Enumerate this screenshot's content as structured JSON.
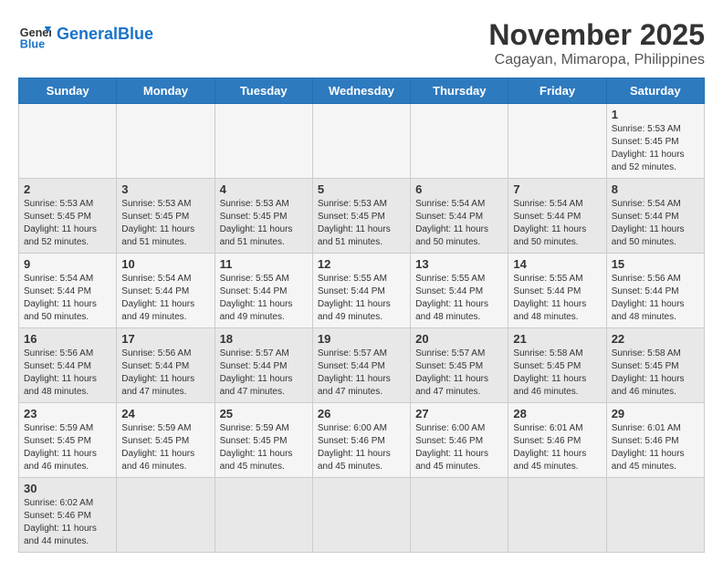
{
  "header": {
    "logo_general": "General",
    "logo_blue": "Blue",
    "month_title": "November 2025",
    "location": "Cagayan, Mimaropa, Philippines"
  },
  "weekdays": [
    "Sunday",
    "Monday",
    "Tuesday",
    "Wednesday",
    "Thursday",
    "Friday",
    "Saturday"
  ],
  "weeks": [
    [
      {
        "day": "",
        "info": ""
      },
      {
        "day": "",
        "info": ""
      },
      {
        "day": "",
        "info": ""
      },
      {
        "day": "",
        "info": ""
      },
      {
        "day": "",
        "info": ""
      },
      {
        "day": "",
        "info": ""
      },
      {
        "day": "1",
        "info": "Sunrise: 5:53 AM\nSunset: 5:45 PM\nDaylight: 11 hours\nand 52 minutes."
      }
    ],
    [
      {
        "day": "2",
        "info": "Sunrise: 5:53 AM\nSunset: 5:45 PM\nDaylight: 11 hours\nand 52 minutes."
      },
      {
        "day": "3",
        "info": "Sunrise: 5:53 AM\nSunset: 5:45 PM\nDaylight: 11 hours\nand 51 minutes."
      },
      {
        "day": "4",
        "info": "Sunrise: 5:53 AM\nSunset: 5:45 PM\nDaylight: 11 hours\nand 51 minutes."
      },
      {
        "day": "5",
        "info": "Sunrise: 5:53 AM\nSunset: 5:45 PM\nDaylight: 11 hours\nand 51 minutes."
      },
      {
        "day": "6",
        "info": "Sunrise: 5:54 AM\nSunset: 5:44 PM\nDaylight: 11 hours\nand 50 minutes."
      },
      {
        "day": "7",
        "info": "Sunrise: 5:54 AM\nSunset: 5:44 PM\nDaylight: 11 hours\nand 50 minutes."
      },
      {
        "day": "8",
        "info": "Sunrise: 5:54 AM\nSunset: 5:44 PM\nDaylight: 11 hours\nand 50 minutes."
      }
    ],
    [
      {
        "day": "9",
        "info": "Sunrise: 5:54 AM\nSunset: 5:44 PM\nDaylight: 11 hours\nand 50 minutes."
      },
      {
        "day": "10",
        "info": "Sunrise: 5:54 AM\nSunset: 5:44 PM\nDaylight: 11 hours\nand 49 minutes."
      },
      {
        "day": "11",
        "info": "Sunrise: 5:55 AM\nSunset: 5:44 PM\nDaylight: 11 hours\nand 49 minutes."
      },
      {
        "day": "12",
        "info": "Sunrise: 5:55 AM\nSunset: 5:44 PM\nDaylight: 11 hours\nand 49 minutes."
      },
      {
        "day": "13",
        "info": "Sunrise: 5:55 AM\nSunset: 5:44 PM\nDaylight: 11 hours\nand 48 minutes."
      },
      {
        "day": "14",
        "info": "Sunrise: 5:55 AM\nSunset: 5:44 PM\nDaylight: 11 hours\nand 48 minutes."
      },
      {
        "day": "15",
        "info": "Sunrise: 5:56 AM\nSunset: 5:44 PM\nDaylight: 11 hours\nand 48 minutes."
      }
    ],
    [
      {
        "day": "16",
        "info": "Sunrise: 5:56 AM\nSunset: 5:44 PM\nDaylight: 11 hours\nand 48 minutes."
      },
      {
        "day": "17",
        "info": "Sunrise: 5:56 AM\nSunset: 5:44 PM\nDaylight: 11 hours\nand 47 minutes."
      },
      {
        "day": "18",
        "info": "Sunrise: 5:57 AM\nSunset: 5:44 PM\nDaylight: 11 hours\nand 47 minutes."
      },
      {
        "day": "19",
        "info": "Sunrise: 5:57 AM\nSunset: 5:44 PM\nDaylight: 11 hours\nand 47 minutes."
      },
      {
        "day": "20",
        "info": "Sunrise: 5:57 AM\nSunset: 5:45 PM\nDaylight: 11 hours\nand 47 minutes."
      },
      {
        "day": "21",
        "info": "Sunrise: 5:58 AM\nSunset: 5:45 PM\nDaylight: 11 hours\nand 46 minutes."
      },
      {
        "day": "22",
        "info": "Sunrise: 5:58 AM\nSunset: 5:45 PM\nDaylight: 11 hours\nand 46 minutes."
      }
    ],
    [
      {
        "day": "23",
        "info": "Sunrise: 5:59 AM\nSunset: 5:45 PM\nDaylight: 11 hours\nand 46 minutes."
      },
      {
        "day": "24",
        "info": "Sunrise: 5:59 AM\nSunset: 5:45 PM\nDaylight: 11 hours\nand 46 minutes."
      },
      {
        "day": "25",
        "info": "Sunrise: 5:59 AM\nSunset: 5:45 PM\nDaylight: 11 hours\nand 45 minutes."
      },
      {
        "day": "26",
        "info": "Sunrise: 6:00 AM\nSunset: 5:46 PM\nDaylight: 11 hours\nand 45 minutes."
      },
      {
        "day": "27",
        "info": "Sunrise: 6:00 AM\nSunset: 5:46 PM\nDaylight: 11 hours\nand 45 minutes."
      },
      {
        "day": "28",
        "info": "Sunrise: 6:01 AM\nSunset: 5:46 PM\nDaylight: 11 hours\nand 45 minutes."
      },
      {
        "day": "29",
        "info": "Sunrise: 6:01 AM\nSunset: 5:46 PM\nDaylight: 11 hours\nand 45 minutes."
      }
    ],
    [
      {
        "day": "30",
        "info": "Sunrise: 6:02 AM\nSunset: 5:46 PM\nDaylight: 11 hours\nand 44 minutes."
      },
      {
        "day": "",
        "info": ""
      },
      {
        "day": "",
        "info": ""
      },
      {
        "day": "",
        "info": ""
      },
      {
        "day": "",
        "info": ""
      },
      {
        "day": "",
        "info": ""
      },
      {
        "day": "",
        "info": ""
      }
    ]
  ]
}
